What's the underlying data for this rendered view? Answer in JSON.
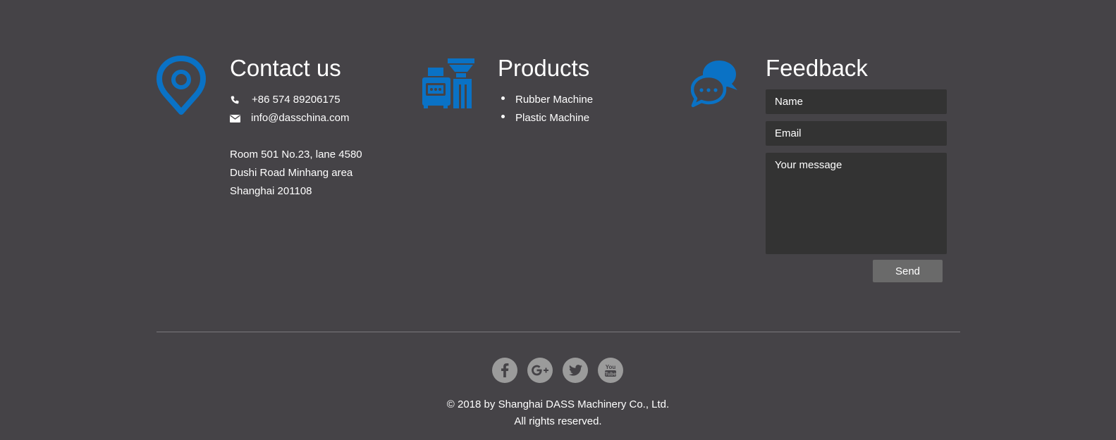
{
  "contact": {
    "title": "Contact us",
    "phone": "+86 574 89206175",
    "email": "info@dasschina.com",
    "address": [
      "Room 501 No.23, lane 4580",
      "Dushi Road Minhang area",
      "Shanghai 201108"
    ],
    "icon": "location-pin-icon"
  },
  "products": {
    "title": "Products",
    "items": [
      "Rubber Machine",
      "Plastic Machine"
    ],
    "icon": "machinery-icon"
  },
  "feedback": {
    "title": "Feedback",
    "name_placeholder": "Name",
    "email_placeholder": "Email",
    "message_placeholder": "Your message",
    "send_label": "Send",
    "icon": "chat-bubbles-icon"
  },
  "social": {
    "icons": [
      "facebook-icon",
      "google-plus-icon",
      "twitter-icon",
      "youtube-icon"
    ]
  },
  "footer": {
    "copyright": "© 2018 by Shanghai DASS Machinery Co., Ltd.",
    "rights": "All rights reserved."
  },
  "colors": {
    "background": "#454347",
    "accent": "#0a72c5",
    "field": "#333333",
    "button": "#6a6a6a",
    "social": "#9b9b9b"
  }
}
